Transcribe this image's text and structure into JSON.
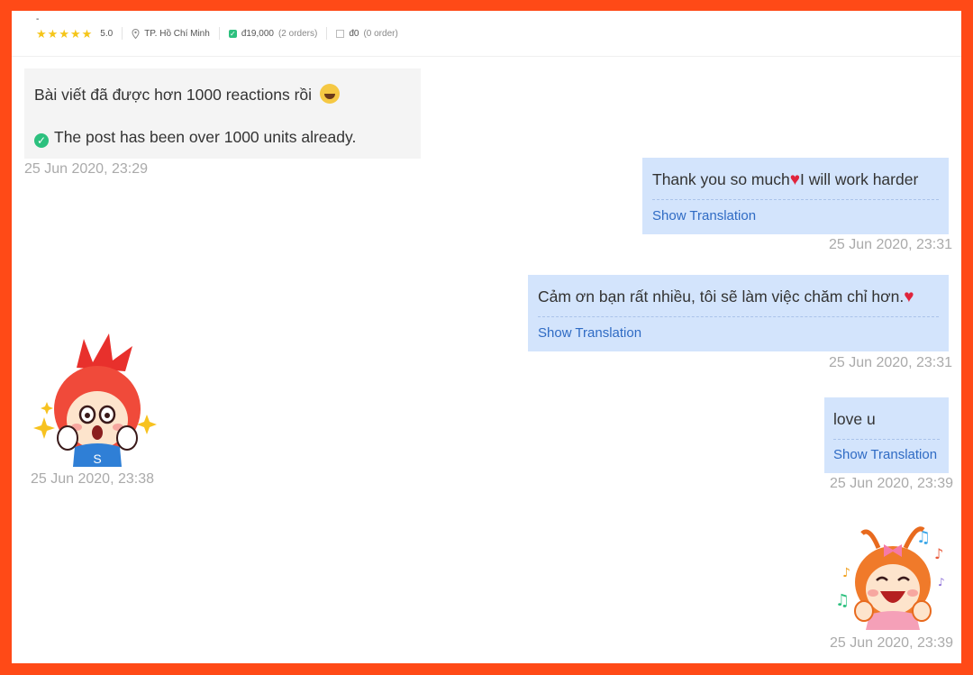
{
  "header": {
    "dash": "-",
    "rating": "5.0",
    "location": "TP. Hồ Chí Minh",
    "sales_amount": "đ19,000",
    "sales_orders": "(2 orders)",
    "other_amount": "đ0",
    "other_orders": "(0 order)"
  },
  "messages": [
    {
      "side": "left",
      "text_vi": "Bài viết đã được hơn 1000 reactions rồi",
      "text_en": "The post has been over 1000 units already.",
      "time": "25 Jun 2020, 23:29"
    },
    {
      "side": "right",
      "text_a": "Thank you so much",
      "text_b": "I will work harder",
      "translate": "Show Translation",
      "time": "25 Jun 2020, 23:31"
    },
    {
      "side": "right",
      "text": "Cảm ơn bạn rất nhiều, tôi sẽ làm việc chăm chỉ hơn.",
      "translate": "Show Translation",
      "time": "25 Jun 2020, 23:31"
    },
    {
      "side": "left",
      "sticker": "boy-sticker",
      "sticker_letter": "S",
      "time": "25 Jun 2020, 23:38"
    },
    {
      "side": "right",
      "text": "love u",
      "translate": "Show Translation",
      "time": "25 Jun 2020, 23:39"
    },
    {
      "side": "right",
      "sticker": "girl-sticker",
      "time": "25 Jun 2020, 23:39"
    }
  ],
  "icons": {
    "star": "star-icon",
    "location": "location-pin-icon",
    "check": "check-icon",
    "heart": "heart-icon"
  },
  "colors": {
    "border": "#ff4a17",
    "bubble_right": "#d3e4fc",
    "bubble_left": "#f4f4f4",
    "link": "#2f6bc4"
  }
}
